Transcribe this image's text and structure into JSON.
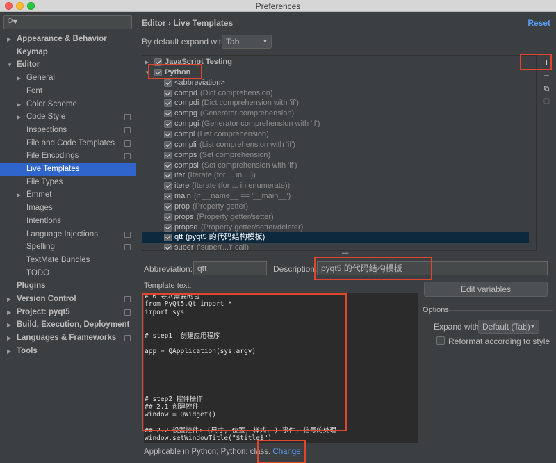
{
  "window": {
    "title": "Preferences"
  },
  "sidebar": {
    "search_placeholder": "",
    "items": [
      {
        "label": "Appearance & Behavior",
        "level": 0,
        "bold": true,
        "arrow": "▶"
      },
      {
        "label": "Keymap",
        "level": 0,
        "bold": true,
        "arrow": ""
      },
      {
        "label": "Editor",
        "level": 0,
        "bold": true,
        "arrow": "▼"
      },
      {
        "label": "General",
        "level": 1,
        "bold": false,
        "arrow": "▶"
      },
      {
        "label": "Font",
        "level": 1,
        "bold": false,
        "arrow": ""
      },
      {
        "label": "Color Scheme",
        "level": 1,
        "bold": false,
        "arrow": "▶"
      },
      {
        "label": "Code Style",
        "level": 1,
        "bold": false,
        "arrow": "▶",
        "page": true
      },
      {
        "label": "Inspections",
        "level": 1,
        "bold": false,
        "arrow": "",
        "page": true
      },
      {
        "label": "File and Code Templates",
        "level": 1,
        "bold": false,
        "arrow": "",
        "page": true
      },
      {
        "label": "File Encodings",
        "level": 1,
        "bold": false,
        "arrow": "",
        "page": true
      },
      {
        "label": "Live Templates",
        "level": 1,
        "bold": false,
        "arrow": "",
        "selected": true
      },
      {
        "label": "File Types",
        "level": 1,
        "bold": false,
        "arrow": ""
      },
      {
        "label": "Emmet",
        "level": 1,
        "bold": false,
        "arrow": "▶"
      },
      {
        "label": "Images",
        "level": 1,
        "bold": false,
        "arrow": ""
      },
      {
        "label": "Intentions",
        "level": 1,
        "bold": false,
        "arrow": ""
      },
      {
        "label": "Language Injections",
        "level": 1,
        "bold": false,
        "arrow": "",
        "page": true
      },
      {
        "label": "Spelling",
        "level": 1,
        "bold": false,
        "arrow": "",
        "page": true
      },
      {
        "label": "TextMate Bundles",
        "level": 1,
        "bold": false,
        "arrow": ""
      },
      {
        "label": "TODO",
        "level": 1,
        "bold": false,
        "arrow": ""
      },
      {
        "label": "Plugins",
        "level": 0,
        "bold": true,
        "arrow": ""
      },
      {
        "label": "Version Control",
        "level": 0,
        "bold": true,
        "arrow": "▶",
        "page": true
      },
      {
        "label": "Project: pyqt5",
        "level": 0,
        "bold": true,
        "arrow": "▶",
        "page": true
      },
      {
        "label": "Build, Execution, Deployment",
        "level": 0,
        "bold": true,
        "arrow": "▶"
      },
      {
        "label": "Languages & Frameworks",
        "level": 0,
        "bold": true,
        "arrow": "▶",
        "page": true
      },
      {
        "label": "Tools",
        "level": 0,
        "bold": true,
        "arrow": "▶"
      }
    ]
  },
  "header": {
    "breadcrumb": "Editor  ›  Live Templates",
    "reset": "Reset",
    "expand_label": "By default expand with",
    "expand_value": "Tab"
  },
  "templates": [
    {
      "name": "JavaScript Testing",
      "desc": "",
      "group": true,
      "arrow": "▶"
    },
    {
      "name": "Python",
      "desc": "",
      "group": true,
      "arrow": "▼"
    },
    {
      "name": "<abbreviation>",
      "desc": ""
    },
    {
      "name": "compd",
      "desc": "(Dict comprehension)"
    },
    {
      "name": "compdi",
      "desc": "(Dict comprehension with 'if')"
    },
    {
      "name": "compg",
      "desc": "(Generator comprehension)"
    },
    {
      "name": "compgi",
      "desc": "(Generator comprehension with 'if')"
    },
    {
      "name": "compl",
      "desc": "(List comprehension)"
    },
    {
      "name": "compli",
      "desc": "(List comprehension with 'if')"
    },
    {
      "name": "comps",
      "desc": "(Set comprehension)"
    },
    {
      "name": "compsi",
      "desc": "(Set comprehension with 'if')"
    },
    {
      "name": "iter",
      "desc": "(Iterate (for ... in ...))"
    },
    {
      "name": "itere",
      "desc": "(Iterate (for ... in enumerate))"
    },
    {
      "name": "main",
      "desc": "(if __name__ == '__main__')"
    },
    {
      "name": "prop",
      "desc": "(Property getter)"
    },
    {
      "name": "props",
      "desc": "(Property getter/setter)"
    },
    {
      "name": "propsd",
      "desc": "(Property getter/setter/deleter)"
    },
    {
      "name": "qtt",
      "desc": "(pyqt5 的代码结构模板)",
      "selected": true
    },
    {
      "name": "super",
      "desc": "('super(...)' call)"
    }
  ],
  "toolbar": {
    "add": "+",
    "remove": "−",
    "copy": "⧉",
    "restore": "▢"
  },
  "form": {
    "abbreviation_label": "Abbreviation:",
    "abbreviation_value": "qtt",
    "description_label": "Description:",
    "description_value": "pyqt5 的代码结构模板",
    "template_text_label": "Template text:",
    "edit_variables": "Edit variables",
    "options_label": "Options",
    "expand_with_label": "Expand with",
    "expand_with_value": "Default (Tab)",
    "reformat_label": "Reformat according to style"
  },
  "template_code": [
    "# 0 导入需要的包",
    "from PyQt5.Qt import *",
    "import sys",
    "",
    "",
    "# step1  创建应用程序",
    "",
    "app = QApplication(sys.argv)",
    "",
    "",
    "",
    "",
    "",
    "# step2 控件操作",
    "## 2.1 创建控件",
    "window = QWidget()",
    "",
    "## 2.2 设置控件: (尺寸, 位置, 样式, ) 事件, 信号的处理",
    "window.setWindowTitle(\"$title$\")"
  ],
  "footer": {
    "applicable_text": "Applicable in Python; Python: class. ",
    "change_link": "Change"
  },
  "colors": {
    "selection": "#2f65ca",
    "link": "#589df6",
    "highlight": "#e0452e"
  }
}
